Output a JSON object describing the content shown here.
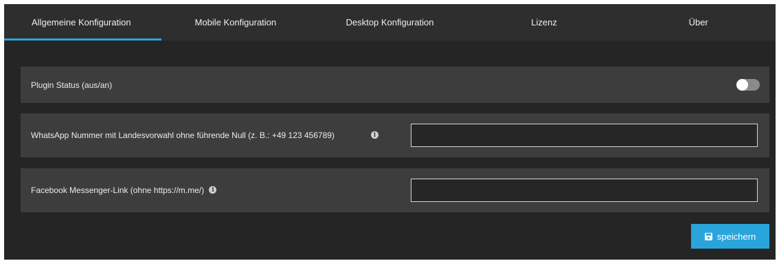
{
  "tabs": [
    {
      "label": "Allgemeine Konfiguration",
      "active": true
    },
    {
      "label": "Mobile Konfiguration",
      "active": false
    },
    {
      "label": "Desktop Konfiguration",
      "active": false
    },
    {
      "label": "Lizenz",
      "active": false
    },
    {
      "label": "Über",
      "active": false
    }
  ],
  "settings": {
    "plugin_status": {
      "label": "Plugin Status (aus/an)",
      "enabled": false
    },
    "whatsapp": {
      "label": "WhatsApp Nummer mit Landesvorwahl ohne führende Null (z. B.: +49 123 456789)",
      "value": "",
      "info_icon": "info-circle-icon"
    },
    "messenger": {
      "label": "Facebook Messenger-Link (ohne https://m.me/)",
      "value": "",
      "info_icon": "info-circle-icon"
    }
  },
  "actions": {
    "save_label": "speichern",
    "save_icon": "floppy-disk-icon"
  },
  "colors": {
    "background": "#252525",
    "tabbar": "#2e2e2e",
    "row": "#3d3d3d",
    "accent": "#2aa5dc"
  }
}
